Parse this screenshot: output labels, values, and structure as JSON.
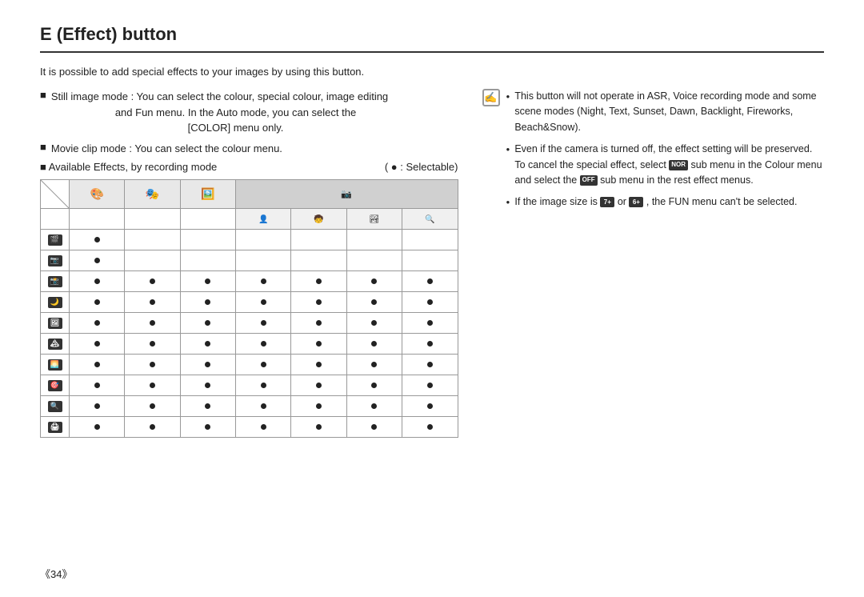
{
  "title": "E (Effect) button",
  "intro": "It is possible to add special effects to your images by using this button.",
  "bullets": [
    {
      "marker": "■",
      "text": "Still image mode : You can select the colour, special colour, image editing and Fun menu. In the Auto mode, you can  select the [COLOR] menu only."
    },
    {
      "marker": "■",
      "text": "Movie clip mode : You can select the colour menu."
    },
    {
      "marker": "■",
      "text": "Available Effects, by recording mode"
    }
  ],
  "selectable_label": "( ● : Selectable)",
  "table": {
    "col_headers": [
      "colour",
      "special_colour",
      "image_edit",
      "fun_sub"
    ],
    "fun_sub_headers": [
      "portrait",
      "children",
      "landscape",
      "close_up"
    ],
    "row_icons": [
      "movie1",
      "movie2",
      "cam1",
      "cam2",
      "cam3",
      "cam4",
      "cam5",
      "cam6",
      "cam7",
      "cam8"
    ],
    "rows": [
      [
        true,
        false,
        false,
        false,
        false,
        false,
        false
      ],
      [
        true,
        false,
        false,
        false,
        false,
        false,
        false
      ],
      [
        true,
        true,
        true,
        true,
        true,
        true,
        true
      ],
      [
        true,
        true,
        true,
        true,
        true,
        true,
        true
      ],
      [
        true,
        true,
        true,
        true,
        true,
        true,
        true
      ],
      [
        true,
        true,
        true,
        true,
        true,
        true,
        true
      ],
      [
        true,
        true,
        true,
        true,
        true,
        true,
        true
      ],
      [
        true,
        true,
        true,
        true,
        true,
        true,
        true
      ],
      [
        true,
        true,
        true,
        true,
        true,
        true,
        true
      ],
      [
        true,
        true,
        true,
        true,
        true,
        true,
        true
      ]
    ]
  },
  "notes": [
    "This button will not operate in ASR, Voice recording mode and some scene modes (Night, Text, Sunset, Dawn, Backlight, Fireworks, Beach&Snow).",
    "Even if the camera is turned off, the effect setting will be preserved. To cancel the special effect, select [NOR] sub menu in the Colour menu and select the [OFF] sub menu in the rest effect menus.",
    "If the image size is [7+] or [6+] , the FUN menu can't be selected."
  ],
  "page_number": "《34》"
}
